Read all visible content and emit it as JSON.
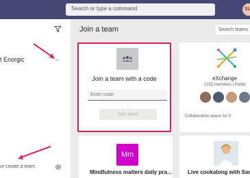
{
  "header": {
    "search_placeholder": "Search or type a command",
    "avatar_initials": "SL"
  },
  "sidebar": {
    "team_name": "t Enorgic",
    "more_label": "...",
    "join_create_label": "or create a team"
  },
  "main": {
    "heading": "Join a team",
    "search_teams_label": "Search teams"
  },
  "join_code_card": {
    "title": "Join a team with a code",
    "input_placeholder": "Enter code",
    "button_label": "Join team"
  },
  "exchange_card": {
    "title": "eXchange",
    "meta": "2152 members | Public",
    "description": "Collaboration space for X"
  },
  "mindfulness_card": {
    "tile_text": "Mm",
    "title": "Mindfulness matters daily pra..."
  },
  "live_card": {
    "title": "Live cookalong with Sarah"
  },
  "colors": {
    "top_bar": "#464775",
    "highlight_border": "#d81b60",
    "annotation_arrow": "#e0245e",
    "accent": "#6264a7",
    "mm_tile": "#d000c9"
  }
}
